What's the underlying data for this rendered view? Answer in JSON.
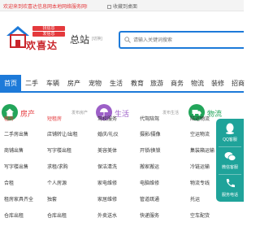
{
  "topbar": {
    "welcome": "欢迎来到欢喜达信息网本地网络服务网!",
    "favorite": "收藏到桌面"
  },
  "logo": {
    "tag_line1": "找信息",
    "tag_line2": "发信息",
    "name": "欢喜达"
  },
  "city": {
    "name": "总站",
    "switch_label": "[切换]"
  },
  "search": {
    "placeholder": "请输入关键词搜索"
  },
  "nav": {
    "items": [
      "首页",
      "二手",
      "车辆",
      "房产",
      "宠物",
      "生活",
      "教育",
      "旅游",
      "商务",
      "物流",
      "装修",
      "招商"
    ]
  },
  "cards": {
    "house": {
      "title": "房产",
      "post": "发布房产",
      "items": [
        "租房",
        "短租房",
        "二手房出售",
        "店铺转让/出租",
        "商铺出售",
        "写字楼出租",
        "写字楼出售",
        "求租/求购",
        "合租",
        "个人房源",
        "租房家具齐全",
        "独套",
        "仓库出租",
        "仓库出租"
      ]
    },
    "life": {
      "title": "生活",
      "post": "发布生活",
      "items": [
        "驾校服务",
        "代驾陪驾",
        "婚庆/礼仪",
        "摄影/摄像",
        "美容美体",
        "开锁/换锁",
        "保洁清洗",
        "搬家搬运",
        "家电维修",
        "电脑维修",
        "家居维修",
        "管道疏通",
        "外卖送水",
        "快递服务"
      ]
    },
    "logistics": {
      "title": "物流",
      "items": [
        "陆运物流",
        "空运物流",
        "集装箱运输",
        "冷链运输",
        "物流专线",
        "托运",
        "空车配货"
      ]
    }
  },
  "side": {
    "qq": "QQ客服",
    "wechat": "微信",
    "weixin_service": "微信客服",
    "phone": "服务电话"
  },
  "colors": {
    "brand_blue": "#1d7ad9",
    "brand_red": "#e4393c",
    "house": "#e4393c",
    "life": "#9c5fc7",
    "logistics": "#22a55a",
    "side": "#1fa39a"
  }
}
